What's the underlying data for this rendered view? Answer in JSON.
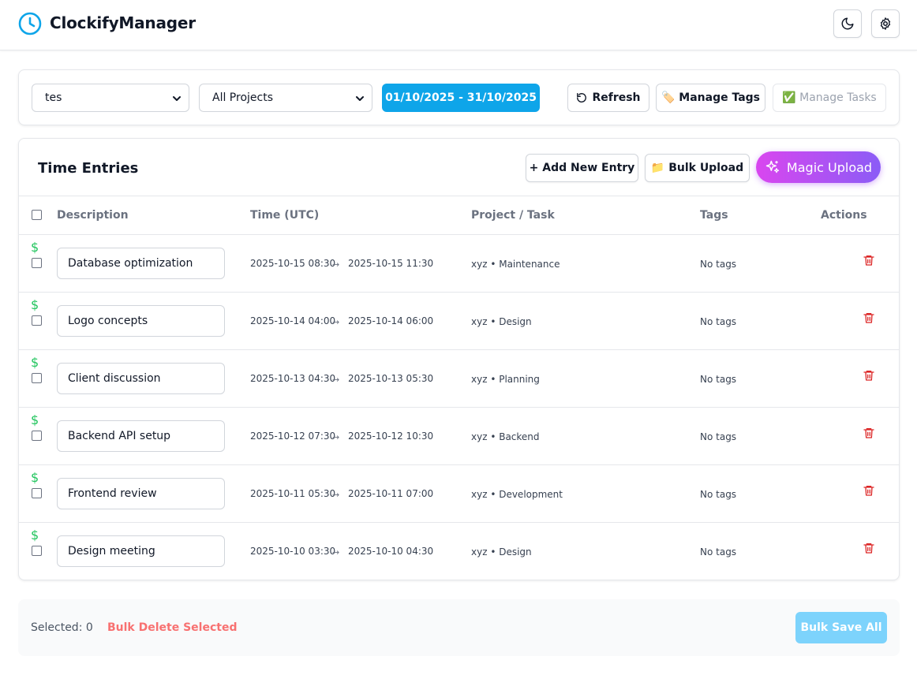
{
  "app": {
    "title": "ClockifyManager"
  },
  "toolbar": {
    "workspace_select": "tes",
    "project_select": "All Projects",
    "date_range": "01/10/2025 - 31/10/2025",
    "refresh_label": "Refresh",
    "manage_tags_label": "🏷️ Manage Tags",
    "manage_tasks_label": "✅ Manage Tasks"
  },
  "entries": {
    "title": "Time Entries",
    "add_label": "+ Add New Entry",
    "bulk_upload_label": "📁 Bulk Upload",
    "magic_upload_label": "Magic Upload",
    "columns": {
      "description": "Description",
      "time": "Time (UTC)",
      "project": "Project / Task",
      "tags": "Tags",
      "actions": "Actions"
    },
    "rows": [
      {
        "billable": "$",
        "description": "Database optimization",
        "start": "2025-10-15 08:30",
        "arrow": "→",
        "end": "2025-10-15 11:30",
        "project": "xyz • Maintenance",
        "tags": "No tags"
      },
      {
        "billable": "$",
        "description": "Logo concepts",
        "start": "2025-10-14 04:00",
        "arrow": "→",
        "end": "2025-10-14 06:00",
        "project": "xyz • Design",
        "tags": "No tags"
      },
      {
        "billable": "$",
        "description": "Client discussion",
        "start": "2025-10-13 04:30",
        "arrow": "→",
        "end": "2025-10-13 05:30",
        "project": "xyz • Planning",
        "tags": "No tags"
      },
      {
        "billable": "$",
        "description": "Backend API setup",
        "start": "2025-10-12 07:30",
        "arrow": "→",
        "end": "2025-10-12 10:30",
        "project": "xyz • Backend",
        "tags": "No tags"
      },
      {
        "billable": "$",
        "description": "Frontend review",
        "start": "2025-10-11 05:30",
        "arrow": "→",
        "end": "2025-10-11 07:00",
        "project": "xyz • Development",
        "tags": "No tags"
      },
      {
        "billable": "$",
        "description": "Design meeting",
        "start": "2025-10-10 03:30",
        "arrow": "→",
        "end": "2025-10-10 04:30",
        "project": "xyz • Design",
        "tags": "No tags"
      }
    ]
  },
  "footer": {
    "selected": "Selected: 0",
    "bulk_delete_label": "Bulk Delete Selected",
    "bulk_save_label": "Bulk Save All"
  },
  "colors": {
    "accent": "#0ea5e9",
    "billable": "#22c55e",
    "danger": "#dc2626",
    "magic_gradient_start": "#d946ef",
    "magic_gradient_end": "#8b5cf6"
  },
  "icons": {
    "logo": "clock-icon",
    "theme": "moon-icon",
    "settings": "gear-icon",
    "refresh": "refresh-icon",
    "magic": "sparkles-icon",
    "delete": "trash-icon"
  }
}
